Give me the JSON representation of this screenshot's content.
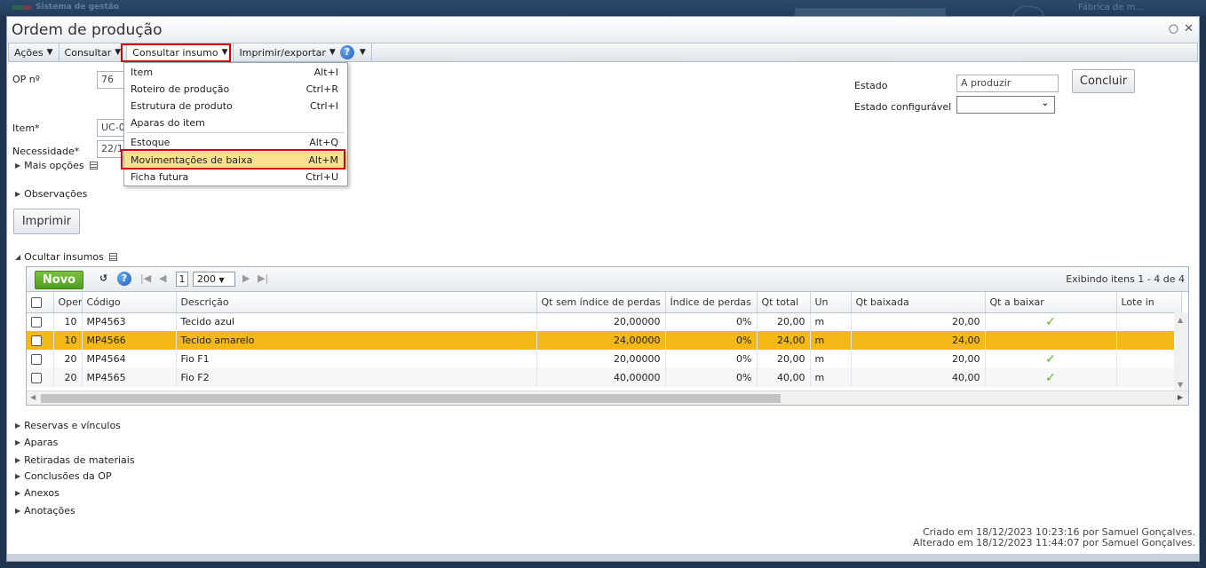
{
  "window": {
    "title": "Ordem de produção",
    "app_name": "Sistema de gestão",
    "company": "Fábrica de m..."
  },
  "menubar": {
    "items": [
      {
        "label": "Ações"
      },
      {
        "label": "Consultar"
      },
      {
        "label": "Consultar insumo"
      },
      {
        "label": "Imprimir/exportar"
      }
    ],
    "help_glyph": "?"
  },
  "dropdown": {
    "items": [
      {
        "label": "Item",
        "shortcut": "Alt+I"
      },
      {
        "label": "Roteiro de produção",
        "shortcut": "Ctrl+R"
      },
      {
        "label": "Estrutura de produto",
        "shortcut": "Ctrl+I"
      },
      {
        "label": "Aparas do item",
        "shortcut": ""
      },
      {
        "label": "Estoque",
        "shortcut": "Alt+Q"
      },
      {
        "label": "Movimentações de baixa",
        "shortcut": "Alt+M",
        "highlighted": true
      },
      {
        "label": "Ficha futura",
        "shortcut": "Ctrl+U"
      }
    ]
  },
  "form": {
    "op_label": "OP nº",
    "op_value": "76",
    "item_label": "Item*",
    "item_value": "UC-0",
    "necessidade_label": "Necessidade*",
    "necessidade_value": "22/1",
    "estado_label": "Estado",
    "estado_value": "A produzir",
    "estado_config_label": "Estado configurável",
    "estado_config_value": "",
    "concluir_label": "Concluir",
    "mais_opcoes": "Mais opções",
    "observacoes": "Observações",
    "imprimir_label": "Imprimir",
    "ocultar_insumos": "Ocultar insumos"
  },
  "grid": {
    "novo_label": "Novo",
    "page": "1",
    "page_size": "200",
    "showing": "Exibindo itens 1 - 4 de 4",
    "columns": [
      "",
      "Oper",
      "Código",
      "Descrição",
      "Qt sem índice de perdas",
      "Índice de perdas",
      "Qt total",
      "Un",
      "Qt baixada",
      "Qt a baixar",
      "Lote in"
    ],
    "rows": [
      {
        "oper": "10",
        "codigo": "MP4563",
        "descricao": "Tecido azul",
        "qt_sem": "20,00000",
        "indice": "0%",
        "qt_total": "20,00",
        "un": "m",
        "qt_baixada": "20,00",
        "qt_a_baixar": "✓",
        "selected": false
      },
      {
        "oper": "10",
        "codigo": "MP4566",
        "descricao": "Tecido amarelo",
        "qt_sem": "24,00000",
        "indice": "0%",
        "qt_total": "24,00",
        "un": "m",
        "qt_baixada": "24,00",
        "qt_a_baixar": "",
        "selected": true
      },
      {
        "oper": "20",
        "codigo": "MP4564",
        "descricao": "Fio F1",
        "qt_sem": "20,00000",
        "indice": "0%",
        "qt_total": "20,00",
        "un": "m",
        "qt_baixada": "20,00",
        "qt_a_baixar": "✓",
        "selected": false
      },
      {
        "oper": "20",
        "codigo": "MP4565",
        "descricao": "Fio F2",
        "qt_sem": "40,00000",
        "indice": "0%",
        "qt_total": "40,00",
        "un": "m",
        "qt_baixada": "40,00",
        "qt_a_baixar": "✓",
        "selected": false
      }
    ]
  },
  "sections": [
    "Reservas e vínculos",
    "Aparas",
    "Retiradas de materiais",
    "Conclusões da OP",
    "Anexos",
    "Anotações"
  ],
  "footer": {
    "created": "Criado em 18/12/2023 10:23:16 por Samuel Gonçalves.",
    "modified": "Alterado em 18/12/2023 11:44:07 por Samuel Gonçalves."
  },
  "colors": {
    "selected_row": "#f3b916",
    "menu_highlight": "#f9e08f",
    "novo_button": "#5aa726",
    "annotation_frame": "#d40000"
  }
}
